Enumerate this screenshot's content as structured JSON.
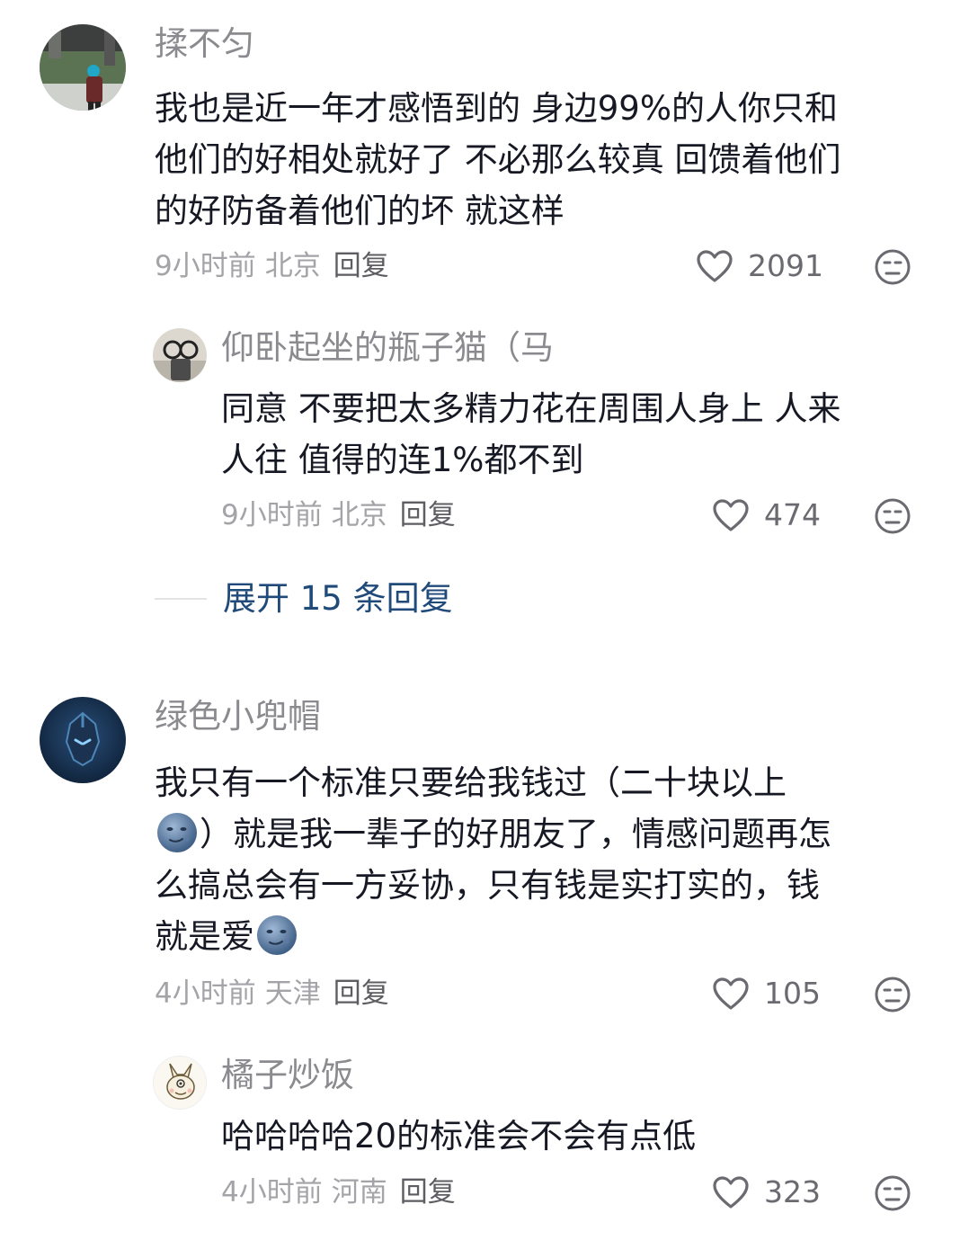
{
  "comments": [
    {
      "user": "揉不匀",
      "lines": [
        "我也是近一年才感悟到的 身边99%的人你只和",
        "他们的好相处就好了 不必那么较真 回馈着他们",
        "的好防备着他们的坏 就这样"
      ],
      "time": "9小时前",
      "location": "北京",
      "reply_label": "回复",
      "likes": "2091",
      "replies": [
        {
          "user": "仰卧起坐的瓶子猫（马",
          "lines": [
            "同意 不要把太多精力花在周围人身上 人来",
            "人往 值得的连1%都不到"
          ],
          "time": "9小时前",
          "location": "北京",
          "reply_label": "回复",
          "likes": "474"
        }
      ],
      "expand_label": "展开 15 条回复"
    },
    {
      "user": "绿色小兜帽",
      "line1": "我只有一个标准只要给我钱过（二十块以上",
      "line2_after_emoji": "）就是我一辈子的好朋友了，情感问题再怎",
      "line3": "么搞总会有一方妥协，只有钱是实打实的，钱",
      "line4_before_emoji": "就是爱",
      "time": "4小时前",
      "location": "天津",
      "reply_label": "回复",
      "likes": "105",
      "replies": [
        {
          "user": "橘子炒饭",
          "lines": [
            "哈哈哈哈20的标准会不会有点低"
          ],
          "time": "4小时前",
          "location": "河南",
          "reply_label": "回复",
          "likes": "323"
        }
      ]
    }
  ],
  "icons": {
    "like": "heart-outline-icon",
    "dislike": "meh-face-icon",
    "emoji": "moon-face-emoji"
  },
  "colors": {
    "username": "#8a8a8f",
    "text": "#161823",
    "meta": "#a3a3a8",
    "expand": "#1f4a7a"
  }
}
